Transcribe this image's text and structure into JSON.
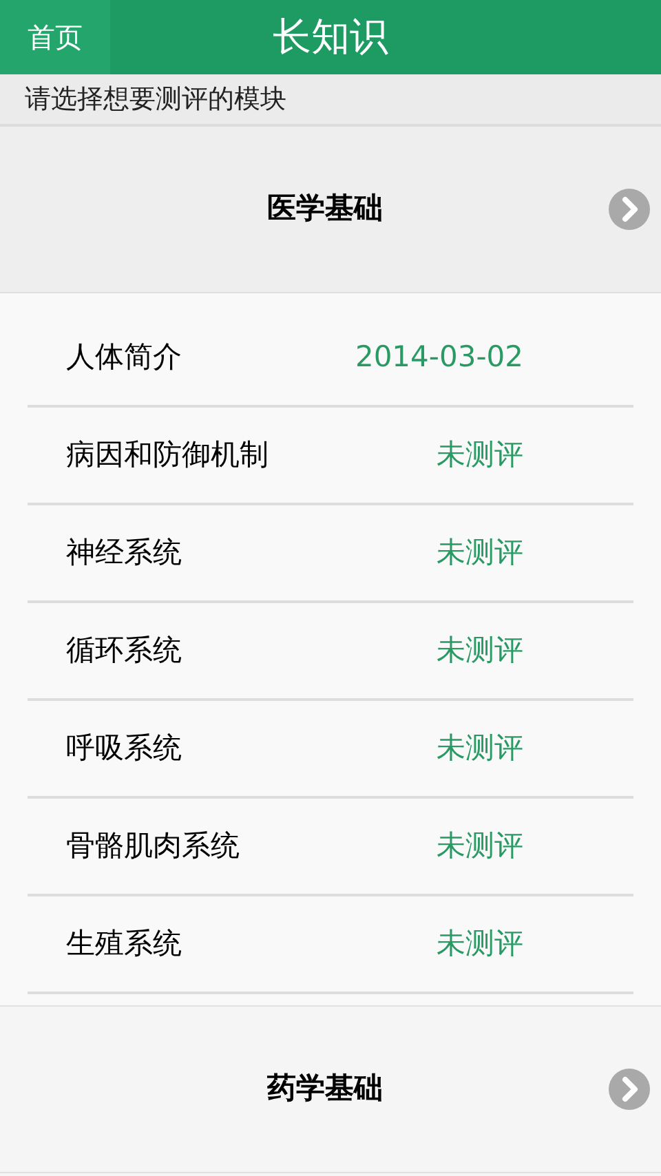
{
  "header": {
    "home_button": "首页",
    "title": "长知识"
  },
  "prompt": "请选择想要测评的模块",
  "modules": [
    {
      "name": "医学基础",
      "items": [
        {
          "name": "人体简介",
          "status": "2014-03-02"
        },
        {
          "name": "病因和防御机制",
          "status": "未测评"
        },
        {
          "name": "神经系统",
          "status": "未测评"
        },
        {
          "name": "循环系统",
          "status": "未测评"
        },
        {
          "name": "呼吸系统",
          "status": "未测评"
        },
        {
          "name": "骨骼肌肉系统",
          "status": "未测评"
        },
        {
          "name": "生殖系统",
          "status": "未测评"
        }
      ]
    },
    {
      "name": "药学基础"
    }
  ]
}
